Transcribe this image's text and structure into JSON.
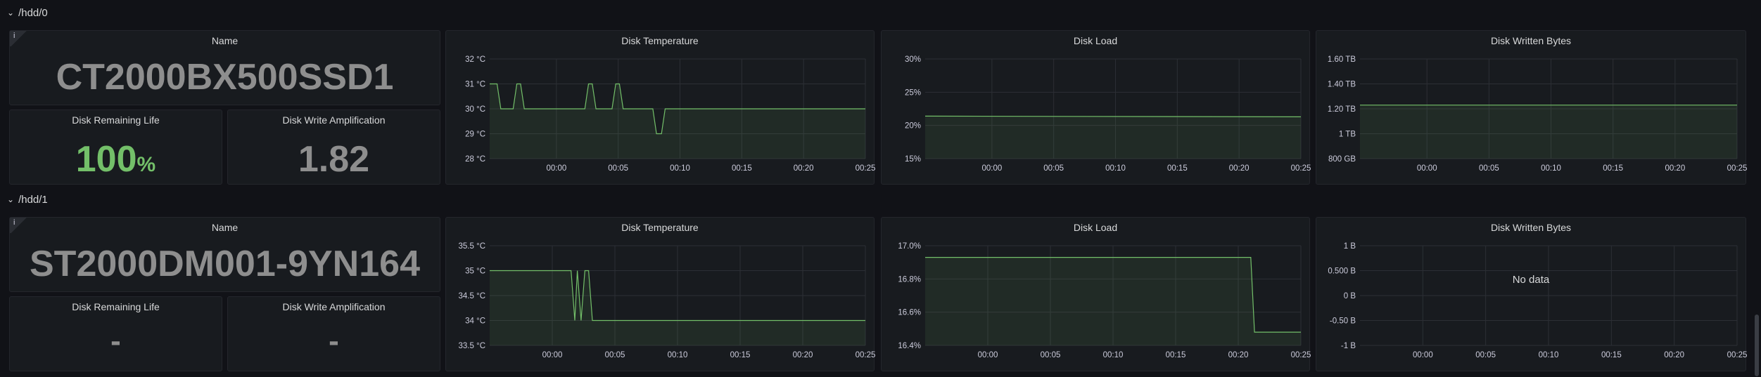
{
  "colors": {
    "background": "#111217",
    "panel": "#181b1f",
    "series": "#73bf69",
    "fill": "rgba(115,191,105,0.10)",
    "green_value": "#73bf69",
    "grey_value": "#8e8e8e"
  },
  "icons": {
    "row_toggle": "chevron-down-icon",
    "info": "info-icon"
  },
  "rows": [
    {
      "title": "/hdd/0",
      "name_panel": {
        "title": "Name",
        "value": "CT2000BX500SSD1",
        "info": "i"
      },
      "life_panel": {
        "title": "Disk Remaining Life",
        "value": "100",
        "unit": "%"
      },
      "wa_panel": {
        "title": "Disk Write Amplification",
        "value": "1.82"
      },
      "temp_panel": {
        "title": "Disk Temperature"
      },
      "load_panel": {
        "title": "Disk Load"
      },
      "bytes_panel": {
        "title": "Disk Written Bytes",
        "nodata": ""
      }
    },
    {
      "title": "/hdd/1",
      "name_panel": {
        "title": "Name",
        "value": "ST2000DM001-9YN164",
        "info": "i"
      },
      "life_panel": {
        "title": "Disk Remaining Life",
        "value": "-",
        "unit": ""
      },
      "wa_panel": {
        "title": "Disk Write Amplification",
        "value": "-"
      },
      "temp_panel": {
        "title": "Disk Temperature"
      },
      "load_panel": {
        "title": "Disk Load"
      },
      "bytes_panel": {
        "title": "Disk Written Bytes",
        "nodata": "No data"
      }
    }
  ],
  "chart_data": [
    {
      "id": "hdd0-temp",
      "type": "area",
      "title": "Disk Temperature",
      "yticks": [
        "32 °C",
        "31 °C",
        "30 °C",
        "29 °C",
        "28 °C"
      ],
      "ylim": [
        28,
        32
      ],
      "xticks": [
        "00:00",
        "00:05",
        "00:10",
        "00:15",
        "00:20",
        "00:25"
      ],
      "xlim": [
        -5.4,
        25
      ],
      "series": [
        {
          "x": [
            -5.4,
            -4.8,
            -4.5,
            -3.5,
            -3.2,
            -2.9,
            -2.6,
            -2.3,
            2.0,
            2.3,
            2.6,
            2.9,
            3.2,
            3.5,
            4.5,
            4.8,
            5.1,
            5.4,
            5.7,
            6.0,
            7.8,
            8.1,
            8.5,
            8.8,
            25
          ],
          "values": [
            31,
            31,
            30,
            30,
            31,
            31,
            30,
            30,
            30,
            30,
            31,
            31,
            30,
            30,
            30,
            31,
            31,
            30,
            30,
            30,
            30,
            29,
            29,
            30,
            30
          ]
        }
      ]
    },
    {
      "id": "hdd0-load",
      "type": "area",
      "title": "Disk Load",
      "yticks": [
        "30%",
        "25%",
        "20%",
        "15%"
      ],
      "ylim": [
        15,
        30
      ],
      "xticks": [
        "00:00",
        "00:05",
        "00:10",
        "00:15",
        "00:20",
        "00:25"
      ],
      "xlim": [
        -5.4,
        25
      ],
      "series": [
        {
          "x": [
            -5.4,
            25
          ],
          "values": [
            21.4,
            21.3
          ]
        }
      ]
    },
    {
      "id": "hdd0-bytes",
      "type": "area",
      "title": "Disk Written Bytes",
      "yticks": [
        "1.60 TB",
        "1.40 TB",
        "1.20 TB",
        "1 TB",
        "800 GB"
      ],
      "ylim": [
        0.8,
        1.6
      ],
      "xticks": [
        "00:00",
        "00:05",
        "00:10",
        "00:15",
        "00:20",
        "00:25"
      ],
      "xlim": [
        -5.4,
        25
      ],
      "series": [
        {
          "x": [
            -5.4,
            25
          ],
          "values": [
            1.23,
            1.23
          ]
        }
      ]
    },
    {
      "id": "hdd1-temp",
      "type": "area",
      "title": "Disk Temperature",
      "yticks": [
        "35.5 °C",
        "35 °C",
        "34.5 °C",
        "34 °C",
        "33.5 °C"
      ],
      "ylim": [
        33.5,
        35.5
      ],
      "xticks": [
        "00:00",
        "00:05",
        "00:10",
        "00:15",
        "00:20",
        "00:25"
      ],
      "xlim": [
        -5.0,
        25
      ],
      "series": [
        {
          "x": [
            -5.0,
            1.5,
            1.8,
            2.0,
            2.3,
            2.6,
            2.9,
            3.2,
            3.5,
            25
          ],
          "values": [
            35,
            35,
            34,
            35,
            34,
            35,
            35,
            34,
            34,
            34
          ]
        }
      ]
    },
    {
      "id": "hdd1-load",
      "type": "area",
      "title": "Disk Load",
      "yticks": [
        "17.0%",
        "16.8%",
        "16.6%",
        "16.4%"
      ],
      "ylim": [
        16.4,
        17.0
      ],
      "xticks": [
        "00:00",
        "00:05",
        "00:10",
        "00:15",
        "00:20",
        "00:25"
      ],
      "xlim": [
        -5.0,
        25
      ],
      "series": [
        {
          "x": [
            -5.0,
            21.0,
            21.3,
            25
          ],
          "values": [
            16.93,
            16.93,
            16.48,
            16.48
          ]
        }
      ]
    },
    {
      "id": "hdd1-bytes",
      "type": "line",
      "title": "Disk Written Bytes",
      "yticks": [
        "1 B",
        "0.500 B",
        "0 B",
        "-0.50 B",
        "-1 B"
      ],
      "ylim": [
        -1,
        1
      ],
      "xticks": [
        "00:00",
        "00:05",
        "00:10",
        "00:15",
        "00:20",
        "00:25"
      ],
      "xlim": [
        -5.0,
        25
      ],
      "series": []
    }
  ]
}
